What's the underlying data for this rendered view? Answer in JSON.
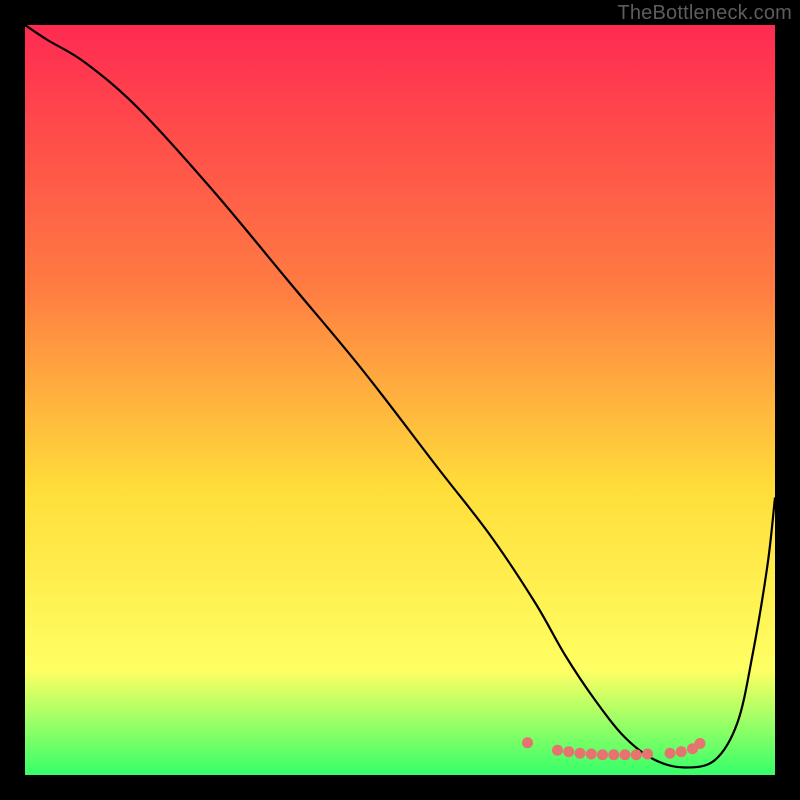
{
  "watermark": "TheBottleneck.com",
  "chart_data": {
    "type": "line",
    "title": "",
    "xlabel": "",
    "ylabel": "",
    "xlim": [
      0,
      100
    ],
    "ylim": [
      0,
      100
    ],
    "background_gradient": {
      "top": "#ff2a51",
      "mid1": "#ff7c42",
      "mid2": "#ffde3a",
      "mid3": "#ffff63",
      "bottom": "#35ff69"
    },
    "series": [
      {
        "name": "curve",
        "color": "#000000",
        "x": [
          0,
          3,
          8,
          15,
          25,
          35,
          45,
          55,
          62,
          68,
          72,
          76,
          80,
          84,
          88,
          92,
          95,
          97,
          99,
          100
        ],
        "y": [
          100,
          98,
          95,
          89,
          78,
          66,
          54,
          41,
          32,
          23,
          16,
          10,
          5,
          2,
          1,
          2,
          7,
          16,
          28,
          37
        ]
      },
      {
        "name": "highlight-dots",
        "color": "#e6736f",
        "x": [
          67,
          71,
          72.5,
          74,
          75.5,
          77,
          78.5,
          80,
          81.5,
          83,
          86,
          87.5,
          89,
          90
        ],
        "y": [
          4.3,
          3.3,
          3.1,
          2.9,
          2.8,
          2.7,
          2.7,
          2.7,
          2.7,
          2.8,
          2.9,
          3.1,
          3.5,
          4.2
        ]
      }
    ]
  }
}
